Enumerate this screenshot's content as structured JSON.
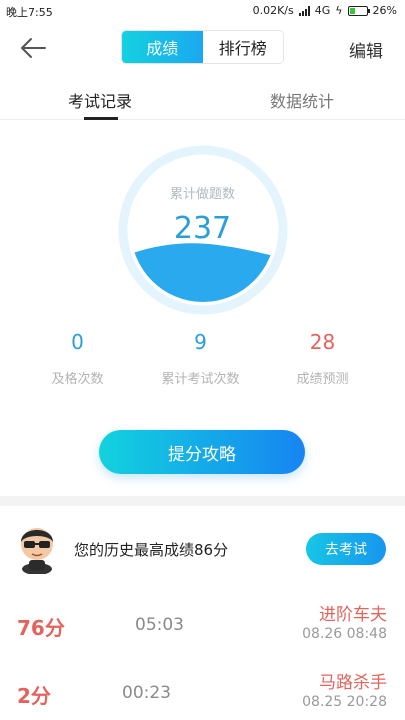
{
  "status_bar": {
    "time": "晚上7:55",
    "speed": "0.02K/s",
    "network": "4G",
    "battery": "26%"
  },
  "header": {
    "tabs": [
      {
        "label": "成绩",
        "active": true
      },
      {
        "label": "排行榜",
        "active": false
      }
    ],
    "edit_label": "编辑",
    "accent_color": "#1ba8f0"
  },
  "sub_tabs": [
    {
      "label": "考试记录",
      "active": true
    },
    {
      "label": "数据统计",
      "active": false
    }
  ],
  "summary": {
    "caption": "累计做题数",
    "value": "237"
  },
  "stats": [
    {
      "value": "0",
      "label": "及格次数",
      "color": "#2a9fd6"
    },
    {
      "value": "9",
      "label": "累计考试次数",
      "color": "#2a9fd6"
    },
    {
      "value": "28",
      "label": "成绩预测",
      "color": "#e2645c"
    }
  ],
  "strategy_button": "提分攻略",
  "best": {
    "text": "您的历史最高成绩86分",
    "button": "去考试"
  },
  "records": [
    {
      "score": "76分",
      "duration": "05:03",
      "title": "进阶车夫",
      "date": "08.26  08:48"
    },
    {
      "score": "2分",
      "duration": "00:23",
      "title": "马路杀手",
      "date": "08.25  20:28"
    }
  ]
}
